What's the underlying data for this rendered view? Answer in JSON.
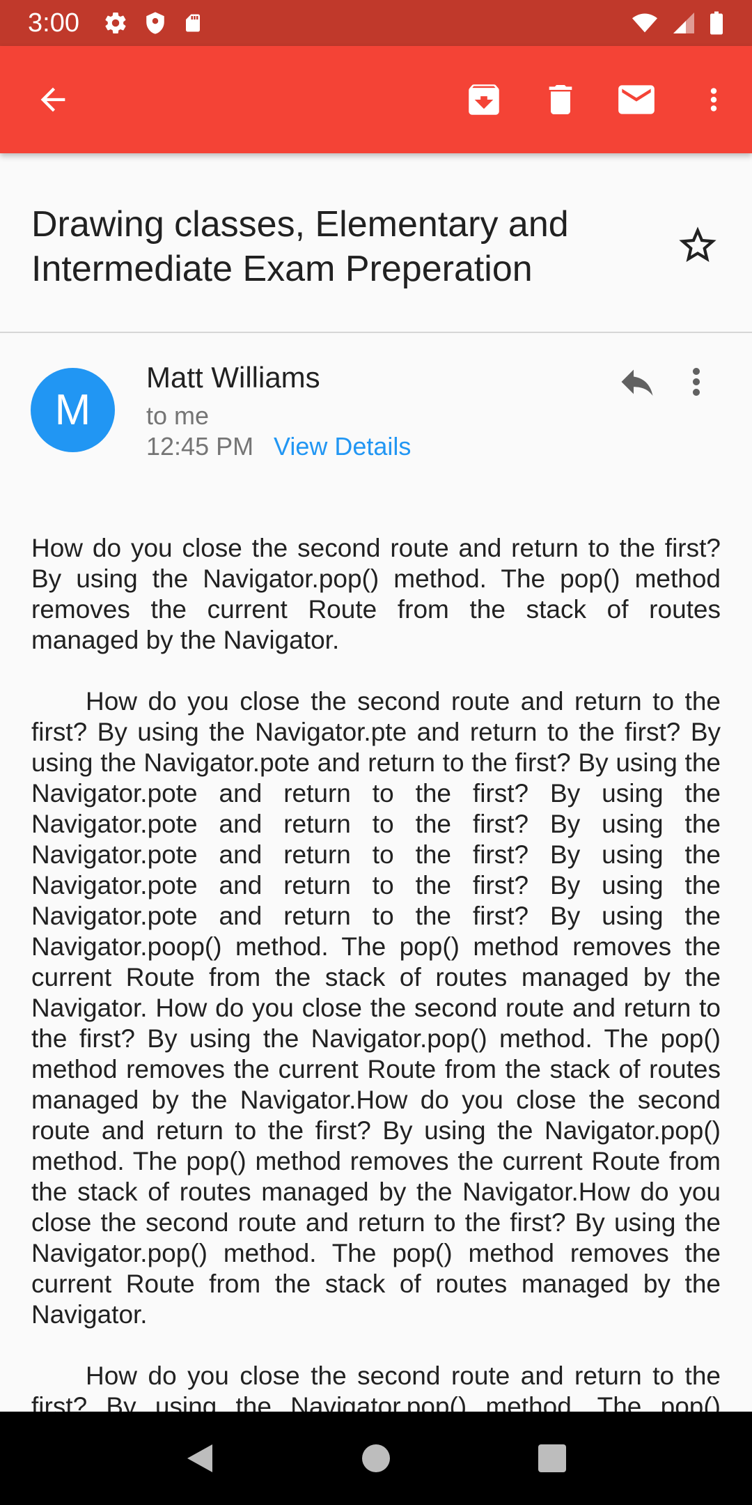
{
  "status_bar": {
    "time": "3:00"
  },
  "app_bar": {
    "icons": [
      "back-arrow-icon",
      "archive-icon",
      "delete-icon",
      "mail-icon",
      "more-vert-icon"
    ]
  },
  "email": {
    "subject": "Drawing classes, Elementary and Intermediate Exam Preperation",
    "sender": {
      "avatar_letter": "M",
      "name": "Matt Williams",
      "to": "to me",
      "time": "12:45 PM",
      "details_link": "View Details"
    },
    "paragraphs": [
      "How do you close the second route and return to the first? By using the Navigator.pop() method. The pop() method removes the current Route from the stack of routes managed by the Navigator.",
      "How do you close the second route and return to the first? By using the Navigator.pte and return to the first? By using the Navigator.pote and return to the first? By using the Navigator.pote and return to the first? By using the Navigator.pote and return to the first? By using the Navigator.pote and return to the first? By using the Navigator.pote and return to the first? By using the Navigator.pote and return to the first? By using the Navigator.poop() method. The pop() method removes the current Route from the stack of routes managed by the Navigator. How do you close the second route and return to the first? By using the Navigator.pop() method. The pop() method removes the current Route from the stack of routes managed by the Navigator.How do you close the second route and return to the first? By using the Navigator.pop() method. The pop() method removes the current Route from the stack of routes managed by the Navigator.How do you close the second route and return to the first? By using the Navigator.pop() method. The pop() method removes the current Route from the stack of routes managed by the Navigator.",
      "How do you close the second route and return to the first? By using the Navigator.pop() method. The pop() method removes the current Route from the stack of routes managed by the Navigator."
    ]
  },
  "colors": {
    "app_bar": "#f44336",
    "status_bar": "#c0392b",
    "avatar": "#2196f3",
    "link": "#2196f3"
  }
}
